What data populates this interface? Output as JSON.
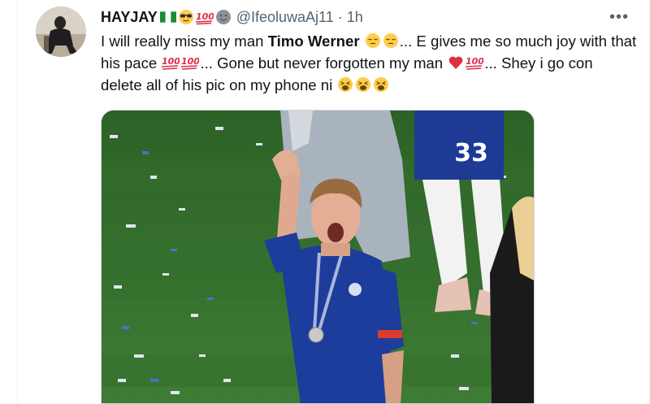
{
  "tweet": {
    "display_name": "HAYJAY",
    "handle": "@IfeoluwaAj11",
    "separator": "·",
    "time": "1h",
    "more_label": "•••",
    "text_intro": "I will really miss my man ",
    "text_name": "Timo Werner",
    "text_mid1": "... E gives me so much joy with that his pace ",
    "text_mid2": "... Gone but never forgotten my man ",
    "text_mid3": "... Shey i go con delete all of his pic on my phone ni ",
    "name_emojis": [
      "nigeria-flag",
      "sunglasses-face",
      "hundred-points",
      "smiling-face"
    ],
    "jersey_number": "33",
    "colors": {
      "text": "#0f1419",
      "secondary": "#536471",
      "pitch": "#2f6b2d",
      "kit_blue": "#1c3d9c"
    }
  }
}
